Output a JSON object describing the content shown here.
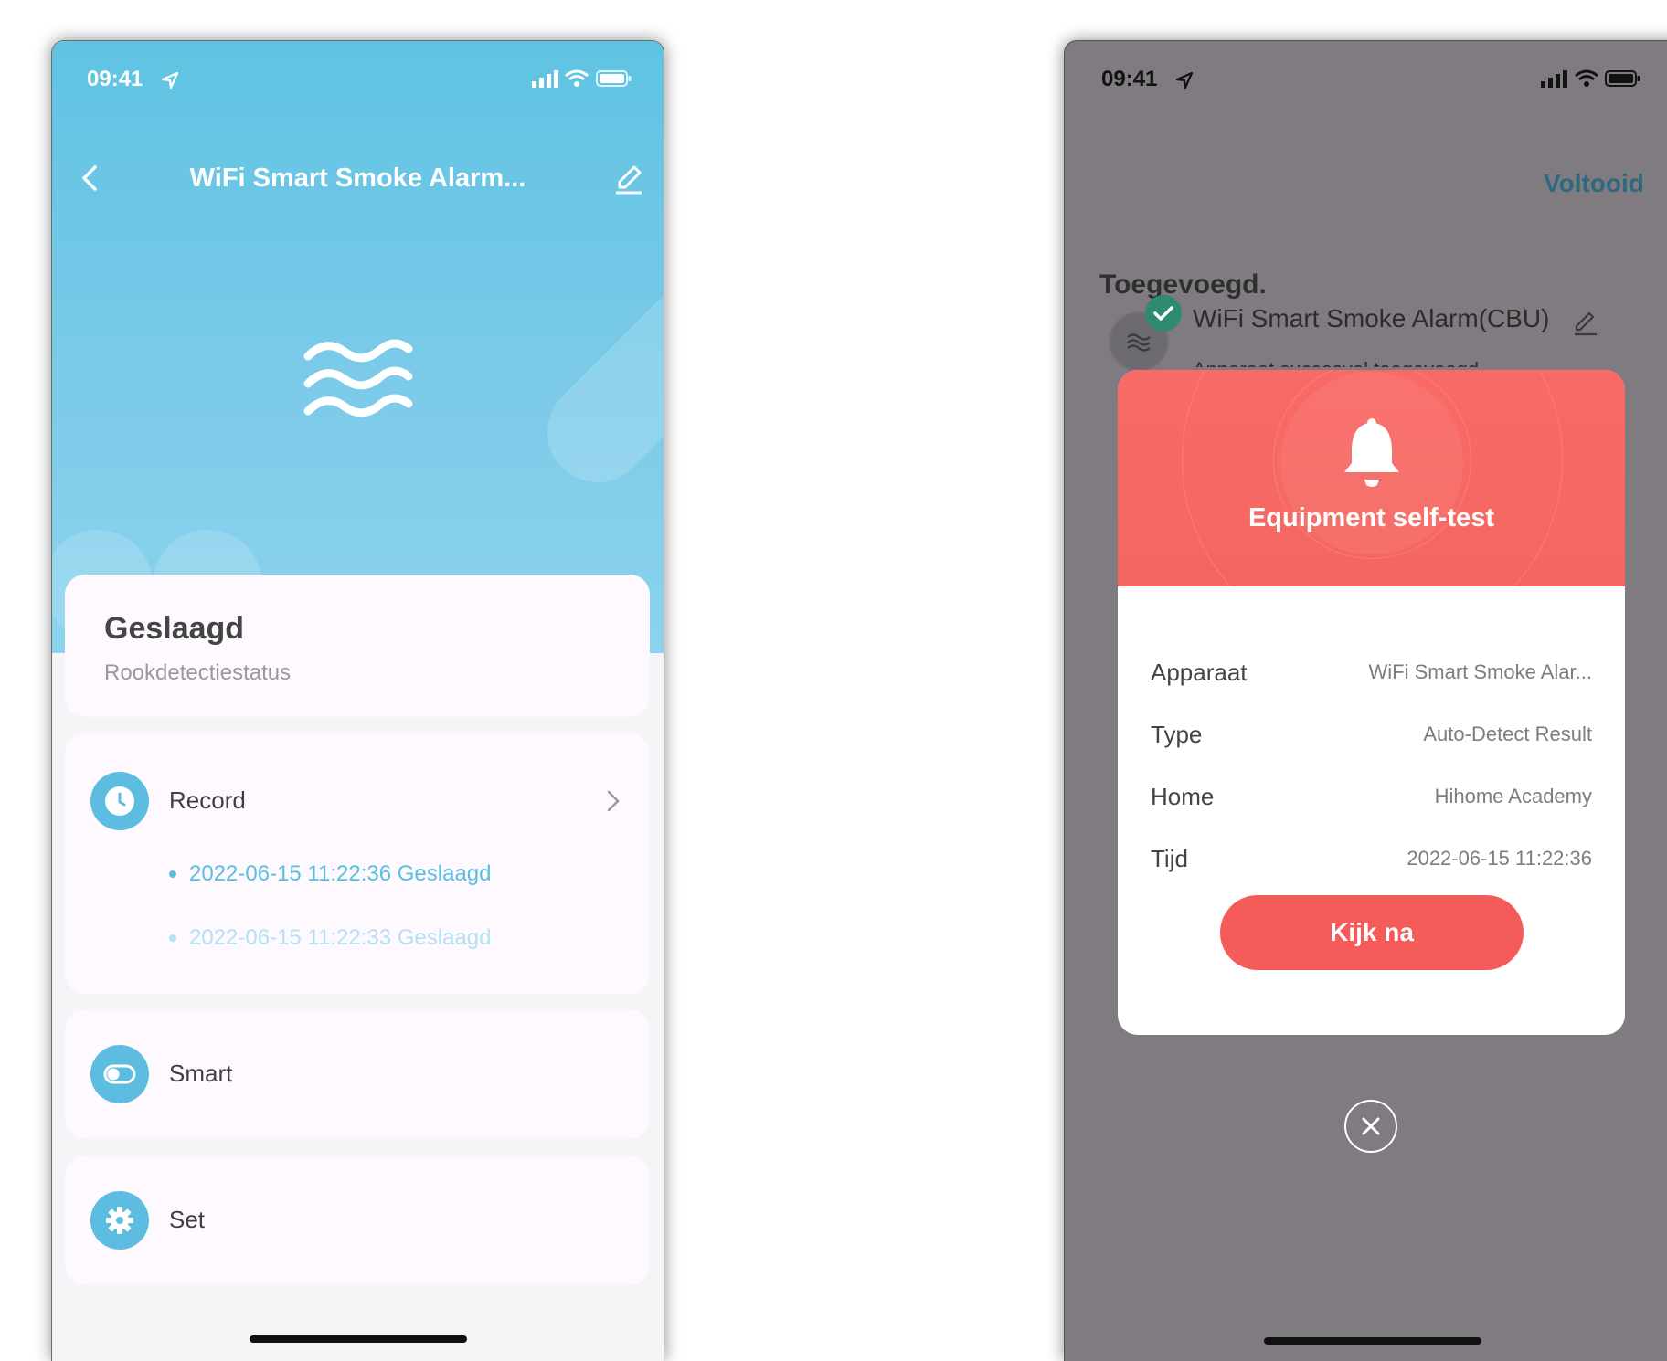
{
  "phone1": {
    "status": {
      "time": "09:41"
    },
    "nav": {
      "title": "WiFi Smart Smoke Alarm..."
    },
    "status_card": {
      "title": "Geslaagd",
      "subtitle": "Rookdetectiestatus"
    },
    "record": {
      "label": "Record",
      "entries": [
        "2022-06-15 11:22:36 Geslaagd",
        "2022-06-15 11:22:33 Geslaagd"
      ]
    },
    "smart": {
      "label": "Smart"
    },
    "set": {
      "label": "Set"
    }
  },
  "phone2": {
    "status": {
      "time": "09:41"
    },
    "done_label": "Voltooid",
    "added_title": "Toegevoegd.",
    "device": {
      "name": "WiFi Smart Smoke Alarm(CBU)",
      "subtitle": "Apparaat succesvol toegevoegd"
    },
    "modal": {
      "title": "Equipment self-test",
      "rows": [
        {
          "key": "Apparaat",
          "value": "WiFi Smart Smoke Alar..."
        },
        {
          "key": "Type",
          "value": "Auto-Detect Result"
        },
        {
          "key": "Home",
          "value": "Hihome Academy"
        },
        {
          "key": "Tijd",
          "value": "2022-06-15 11:22:36"
        }
      ],
      "cta_label": "Kijk na"
    }
  },
  "colors": {
    "accent_blue": "#5cbde0",
    "alarm_red": "#f55c59",
    "done_teal": "#2e6a7f"
  }
}
